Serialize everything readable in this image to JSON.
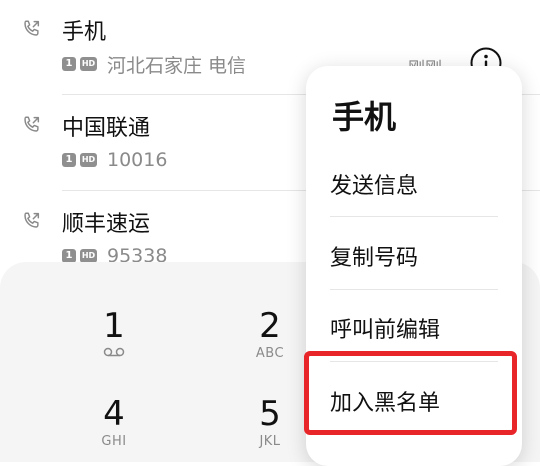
{
  "calls": [
    {
      "name": "手机",
      "sim": "1",
      "hd": "HD",
      "detail": "河北石家庄 电信",
      "time": "刚刚"
    },
    {
      "name": "中国联通",
      "sim": "1",
      "hd": "HD",
      "detail": "10016"
    },
    {
      "name": "顺丰速运",
      "sim": "1",
      "hd": "HD",
      "detail": "95338"
    }
  ],
  "context_menu": {
    "title": "手机",
    "items": [
      {
        "label": "发送信息"
      },
      {
        "label": "复制号码"
      },
      {
        "label": "呼叫前编辑"
      },
      {
        "label": "加入黑名单"
      }
    ]
  },
  "dialpad": {
    "keys": [
      {
        "digit": "1",
        "letters": ""
      },
      {
        "digit": "2",
        "letters": "ABC"
      },
      {
        "digit": "4",
        "letters": "GHI"
      },
      {
        "digit": "5",
        "letters": "JKL"
      }
    ]
  },
  "colors": {
    "highlight": "#e8262a",
    "secondary_text": "#8a8a8a",
    "dialpad_bg": "#f5f5f5"
  },
  "icons": {
    "call": "outgoing-call-icon",
    "info": "info-icon",
    "voicemail": "voicemail-icon"
  }
}
